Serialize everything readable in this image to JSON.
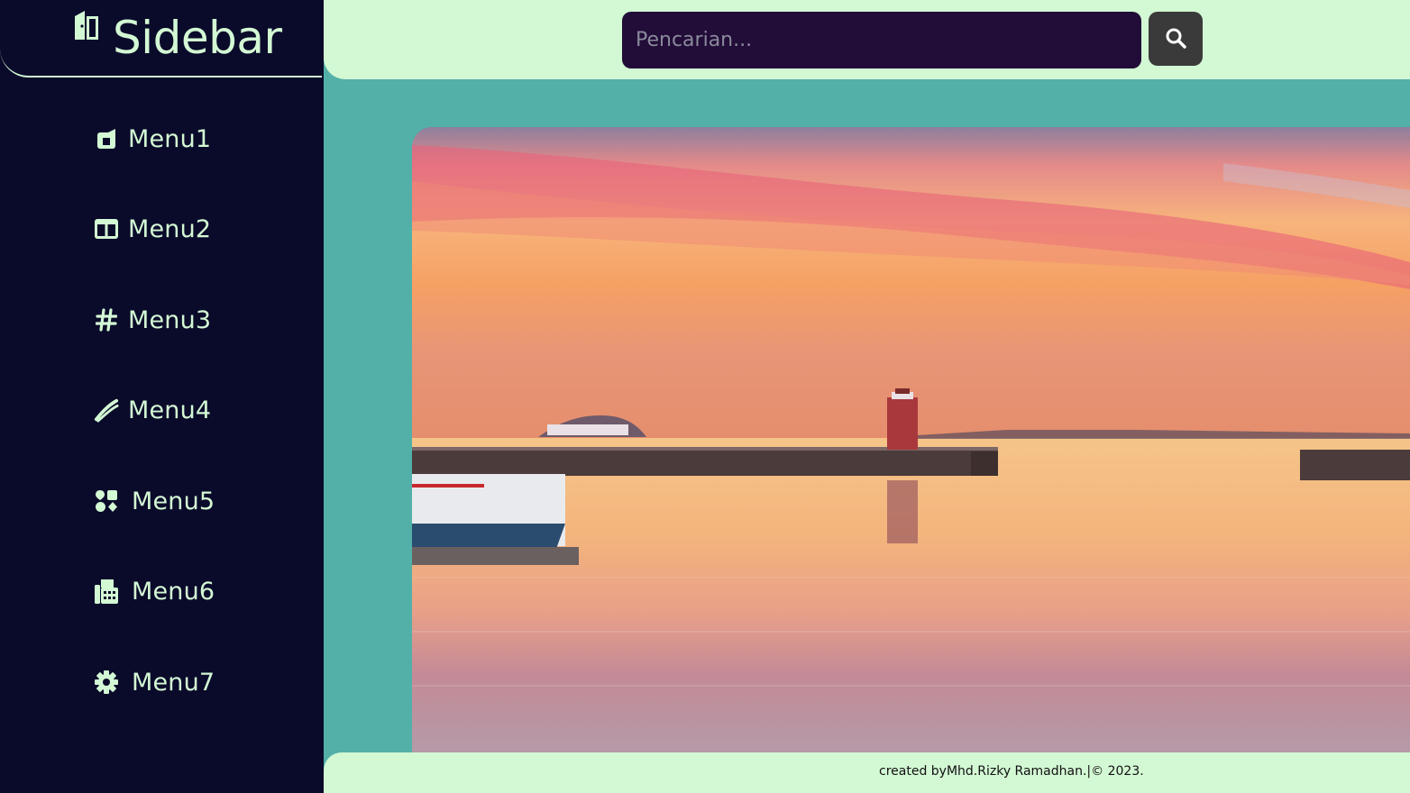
{
  "sidebar": {
    "brand": {
      "title": "Sidebar",
      "icon": "door-open-icon"
    },
    "items": [
      {
        "label": "Menu1",
        "icon": "square-icon"
      },
      {
        "label": "Menu2",
        "icon": "columns-icon"
      },
      {
        "label": "Menu3",
        "icon": "hashtag-icon"
      },
      {
        "label": "Menu4",
        "icon": "slash-brush-icon"
      },
      {
        "label": "Menu5",
        "icon": "shapes-icon"
      },
      {
        "label": "Menu6",
        "icon": "fax-icon"
      },
      {
        "label": "Menu7",
        "icon": "gear-icon"
      }
    ]
  },
  "search": {
    "placeholder": "Pencarian...",
    "value": "",
    "icon": "search-icon"
  },
  "main": {
    "image": "sunset-harbor-lighthouse-photo"
  },
  "footer": {
    "text": "created byMhd.Rizky Ramadhan.|© 2023."
  },
  "colors": {
    "sidebar_bg": "#0a0a2a",
    "accent": "#d3f8d4",
    "content_bg": "#52b0a8",
    "search_bg": "#220c38",
    "search_button_bg": "#3a3a3a"
  }
}
